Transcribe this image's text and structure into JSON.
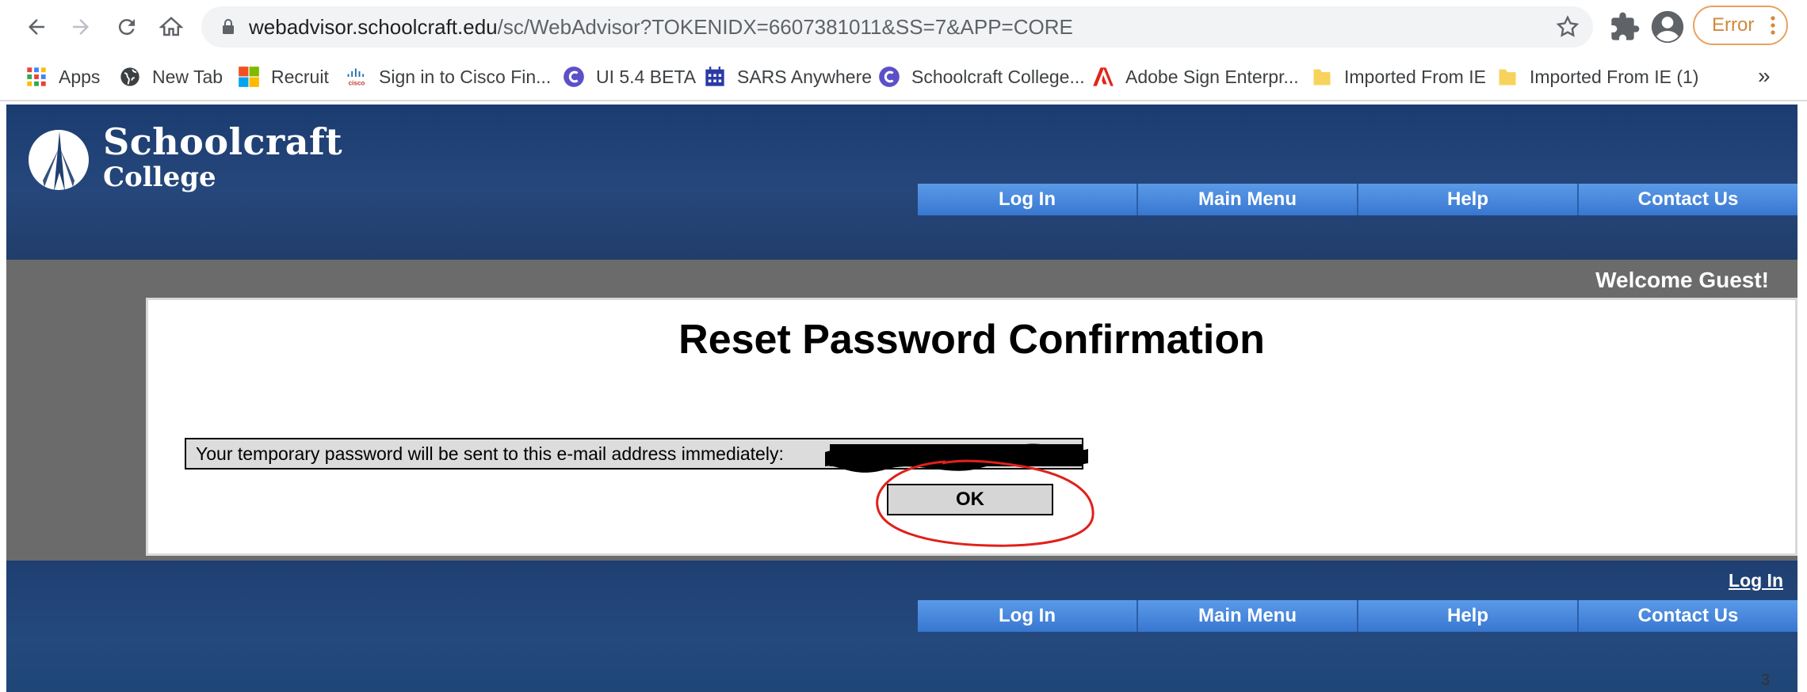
{
  "browser": {
    "url_host": "webadvisor.schoolcraft.edu",
    "url_path": "/sc/WebAdvisor?TOKENIDX=6607381011&SS=7&APP=CORE",
    "error_label": "Error"
  },
  "bookmarks": [
    {
      "label": "Apps",
      "icon": "apps-grid-icon"
    },
    {
      "label": "New Tab",
      "icon": "globe-icon"
    },
    {
      "label": "Recruit",
      "icon": "microsoft-icon"
    },
    {
      "label": "Sign in to Cisco Fin...",
      "icon": "cisco-icon"
    },
    {
      "label": "UI 5.4 BETA",
      "icon": "ellucian-icon"
    },
    {
      "label": "SARS Anywhere",
      "icon": "calendar-icon"
    },
    {
      "label": "Schoolcraft College...",
      "icon": "ellucian-icon"
    },
    {
      "label": "Adobe Sign Enterpr...",
      "icon": "adobe-icon"
    },
    {
      "label": "Imported From IE",
      "icon": "folder-icon"
    },
    {
      "label": "Imported From IE (1)",
      "icon": "folder-icon"
    }
  ],
  "bookmarks_more": "»",
  "site": {
    "logo_line1": "Schoolcraft",
    "logo_line2": "College",
    "menu": [
      "Log In",
      "Main Menu",
      "Help",
      "Contact Us"
    ],
    "welcome": "Welcome Guest!",
    "footer_login": "Log In"
  },
  "main": {
    "title": "Reset Password Confirmation",
    "message": "Your temporary password will be sent to this e-mail address immediately:",
    "ok_label": "OK"
  },
  "page_number": "3",
  "colors": {
    "header_blue": "#1b3c70",
    "menu_blue": "#3f7fd6",
    "gray_band": "#6b6b6b",
    "annotation_red": "#e0201b",
    "error_orange": "#e8a25e"
  }
}
